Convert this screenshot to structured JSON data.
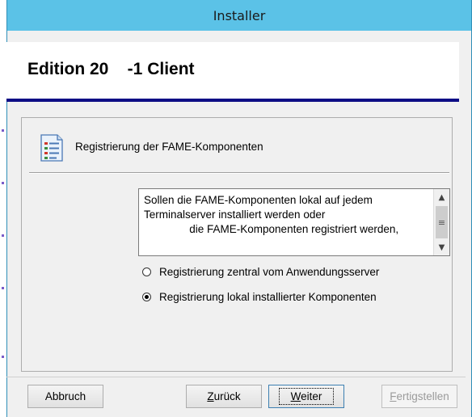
{
  "window": {
    "title": "Installer"
  },
  "header": {
    "title": "Edition 20    -1 Client"
  },
  "step": {
    "icon": "checklist-document-icon",
    "title": "Registrierung der FAME-Komponenten"
  },
  "info_text": {
    "line1": "Sollen die FAME-Komponenten lokal auf jedem",
    "line2": "Terminalserver installiert werden oder",
    "line3": "               die FAME-Komponenten registriert werden,"
  },
  "options": [
    {
      "label": "Registrierung zentral vom Anwendungsserver",
      "selected": false
    },
    {
      "label": "Registrierung lokal installierter Komponenten",
      "selected": true
    }
  ],
  "buttons": {
    "cancel": "Abbruch",
    "back_accel": "Z",
    "back_rest": "urück",
    "next_accel": "W",
    "next_rest": "eiter",
    "finish_accel": "F",
    "finish_rest": "ertigstellen"
  },
  "colors": {
    "titlebar": "#5bc2e7",
    "header_rule": "#0d0d85",
    "dialog_bg": "#f0f0f0"
  }
}
